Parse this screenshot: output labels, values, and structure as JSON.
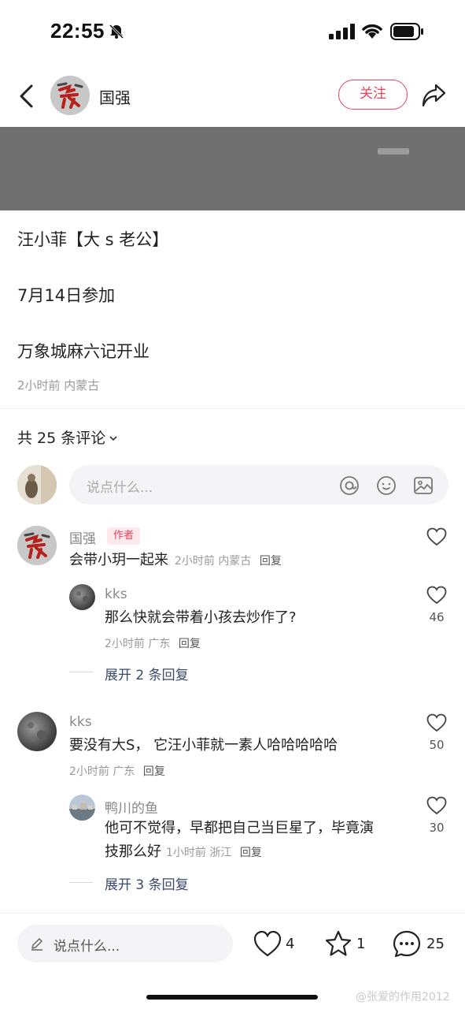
{
  "status": {
    "time": "22:55"
  },
  "header": {
    "author_name": "国强",
    "follow_label": "关注"
  },
  "post": {
    "lines": [
      "汪小菲【大 s 老公】",
      "7月14日参加",
      "万象城麻六记开业"
    ],
    "meta": "2小时前 内蒙古"
  },
  "comments_header": {
    "label": "共 25 条评论"
  },
  "comment_input": {
    "placeholder": "说点什么..."
  },
  "comments": [
    {
      "name": "国强",
      "badge": "作者",
      "text": "会带小玥一起来",
      "time": "2小时前",
      "location": "内蒙古",
      "reply": "回复",
      "replies": [
        {
          "name": "kks",
          "text": "那么快就会带着小孩去炒作了?",
          "time": "2小时前",
          "location": "广东",
          "reply": "回复",
          "likes": "46"
        }
      ],
      "expand": "展开 2 条回复"
    },
    {
      "name": "kks",
      "text": "要没有大S， 它汪小菲就一素人哈哈哈哈哈",
      "time": "2小时前",
      "location": "广东",
      "reply": "回复",
      "likes": "50",
      "replies": [
        {
          "name": "鸭川的鱼",
          "text_line1": "他可不觉得，早都把自己当巨星了，毕竟演",
          "text_line2": "技那么好",
          "time": "1小时前",
          "location": "浙江",
          "reply": "回复",
          "likes": "30"
        }
      ],
      "expand": "展开 3 条回复"
    }
  ],
  "bottom_bar": {
    "placeholder": "说点什么...",
    "likes": "4",
    "favorites": "1",
    "comments": "25"
  },
  "watermark": "@张爱的作用2012",
  "colors": {
    "accent": "#e8445c",
    "link": "#3a4a6b",
    "banner": "#6f6f6f"
  }
}
